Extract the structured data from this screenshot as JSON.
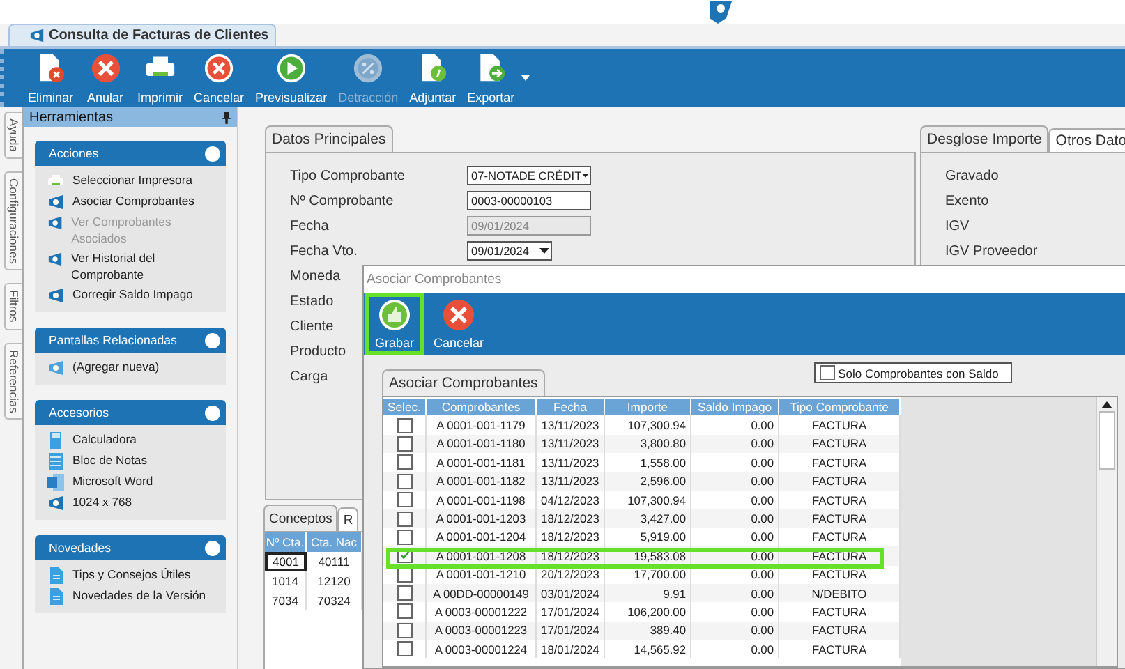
{
  "document_tab": {
    "title": "Consulta de Facturas de Clientes"
  },
  "toolbar": [
    {
      "label": "Eliminar",
      "kind": "delete-doc",
      "disabled": false
    },
    {
      "label": "Anular",
      "kind": "cancel",
      "disabled": false
    },
    {
      "label": "Imprimir",
      "kind": "printer",
      "disabled": false
    },
    {
      "label": "Cancelar",
      "kind": "cancel-ring",
      "disabled": false
    },
    {
      "label": "Previsualizar",
      "kind": "play",
      "disabled": false
    },
    {
      "label": "Detracción",
      "kind": "percent",
      "disabled": true
    },
    {
      "label": "Adjuntar",
      "kind": "attach-doc",
      "disabled": false
    },
    {
      "label": "Exportar",
      "kind": "export-doc",
      "disabled": false
    }
  ],
  "side_tabs": [
    {
      "label": "Ayuda"
    },
    {
      "label": "Configuraciones"
    },
    {
      "label": "Filtros"
    },
    {
      "label": "Referencias"
    }
  ],
  "tools_panel": {
    "title": "Herramientas",
    "sections": [
      {
        "title": "Acciones",
        "items": [
          {
            "label": "Seleccionar Impresora",
            "kind": "printer",
            "disabled": false
          },
          {
            "label": "Asociar Comprobantes",
            "kind": "logo",
            "disabled": false
          },
          {
            "label": "Ver Comprobantes Asociados",
            "kind": "logo",
            "disabled": true
          },
          {
            "label": "Ver Historial del Comprobante",
            "kind": "logo",
            "disabled": false
          },
          {
            "label": "Corregir Saldo Impago",
            "kind": "logo",
            "disabled": false
          }
        ]
      },
      {
        "title": "Pantallas Relacionadas",
        "items": [
          {
            "label": "(Agregar nueva)",
            "kind": "logo-light",
            "disabled": false
          }
        ]
      },
      {
        "title": "Accesorios",
        "items": [
          {
            "label": "Calculadora",
            "kind": "calculator",
            "disabled": false
          },
          {
            "label": "Bloc de Notas",
            "kind": "notepad",
            "disabled": false
          },
          {
            "label": "Microsoft Word",
            "kind": "word",
            "disabled": false
          },
          {
            "label": "1024 x 768",
            "kind": "logo",
            "disabled": false
          }
        ]
      },
      {
        "title": "Novedades",
        "items": [
          {
            "label": "Tips y Consejos Útiles",
            "kind": "document",
            "disabled": false
          },
          {
            "label": "Novedades de la Versión",
            "kind": "document",
            "disabled": false
          }
        ]
      }
    ]
  },
  "main_form": {
    "tab": "Datos Principales",
    "fields": [
      {
        "label": "Tipo Comprobante",
        "kind": "select",
        "value": "07-NOTADE CRÉDIT",
        "disabled": false
      },
      {
        "label": "Nº Comprobante",
        "kind": "text",
        "value": "0003-00000103",
        "disabled": false
      },
      {
        "label": "Fecha",
        "kind": "text",
        "value": "09/01/2024",
        "disabled": true
      },
      {
        "label": "Fecha Vto.",
        "kind": "date",
        "value": "09/01/2024",
        "disabled": false
      },
      {
        "label": "Moneda"
      },
      {
        "label": "Estado"
      },
      {
        "label": "Cliente"
      },
      {
        "label": "Producto"
      },
      {
        "label": "Carga"
      }
    ]
  },
  "summary": {
    "tabs": [
      {
        "label": "Desglose Importe",
        "selected": true
      },
      {
        "label": "Otros Dato",
        "selected": false
      }
    ],
    "labels": [
      "Gravado",
      "Exento",
      "IGV",
      "IGV Proveedor"
    ]
  },
  "concepts": {
    "tabs": [
      {
        "label": "Conceptos",
        "selected": true
      },
      {
        "label": "R",
        "selected": false
      }
    ],
    "columns": [
      "Nº Cta.",
      "Cta. Nac"
    ],
    "rows": [
      {
        "cells": [
          "4001",
          "40111"
        ],
        "selected": true
      },
      {
        "cells": [
          "1014",
          "12120"
        ],
        "selected": false
      },
      {
        "cells": [
          "7034",
          "70324"
        ],
        "selected": false
      }
    ]
  },
  "dialog": {
    "title": "Asociar Comprobantes",
    "buttons": [
      {
        "label": "Grabar",
        "kind": "save",
        "highlighted": true
      },
      {
        "label": "Cancelar",
        "kind": "cancel",
        "highlighted": false
      }
    ],
    "tab": "Asociar Comprobantes",
    "filter": {
      "label": "Solo Comprobantes con Saldo",
      "checked": false
    },
    "table": {
      "check_column": "Selec.",
      "columns": [
        "Comprobantes",
        "Fecha",
        "Importe",
        "Saldo Impago",
        "Tipo Comprobante"
      ],
      "rows": [
        {
          "checked": false,
          "cells": [
            "A 0001-001-1179",
            "13/11/2023",
            "107,300.94",
            "0.00",
            "FACTURA"
          ]
        },
        {
          "checked": false,
          "cells": [
            "A 0001-001-1180",
            "13/11/2023",
            "3,800.80",
            "0.00",
            "FACTURA"
          ]
        },
        {
          "checked": false,
          "cells": [
            "A 0001-001-1181",
            "13/11/2023",
            "1,558.00",
            "0.00",
            "FACTURA"
          ]
        },
        {
          "checked": false,
          "cells": [
            "A 0001-001-1182",
            "13/11/2023",
            "2,596.00",
            "0.00",
            "FACTURA"
          ]
        },
        {
          "checked": false,
          "cells": [
            "A 0001-001-1198",
            "04/12/2023",
            "107,300.94",
            "0.00",
            "FACTURA"
          ]
        },
        {
          "checked": false,
          "cells": [
            "A 0001-001-1203",
            "18/12/2023",
            "3,427.00",
            "0.00",
            "FACTURA"
          ]
        },
        {
          "checked": false,
          "cells": [
            "A 0001-001-1204",
            "18/12/2023",
            "5,919.00",
            "0.00",
            "FACTURA"
          ]
        },
        {
          "checked": true,
          "cells": [
            "A 0001-001-1208",
            "18/12/2023",
            "19,583.08",
            "0.00",
            "FACTURA"
          ]
        },
        {
          "checked": false,
          "cells": [
            "A 0001-001-1210",
            "20/12/2023",
            "17,700.00",
            "0.00",
            "FACTURA"
          ]
        },
        {
          "checked": false,
          "cells": [
            "A 00DD-00000149",
            "03/01/2024",
            "9.91",
            "0.00",
            "N/DEBITO"
          ]
        },
        {
          "checked": false,
          "cells": [
            "A 0003-00001222",
            "17/01/2024",
            "106,200.00",
            "0.00",
            "FACTURA"
          ]
        },
        {
          "checked": false,
          "cells": [
            "A 0003-00001223",
            "17/01/2024",
            "389.40",
            "0.00",
            "FACTURA"
          ]
        },
        {
          "checked": false,
          "cells": [
            "A 0003-00001224",
            "18/01/2024",
            "14,565.92",
            "0.00",
            "FACTURA"
          ]
        }
      ]
    }
  }
}
